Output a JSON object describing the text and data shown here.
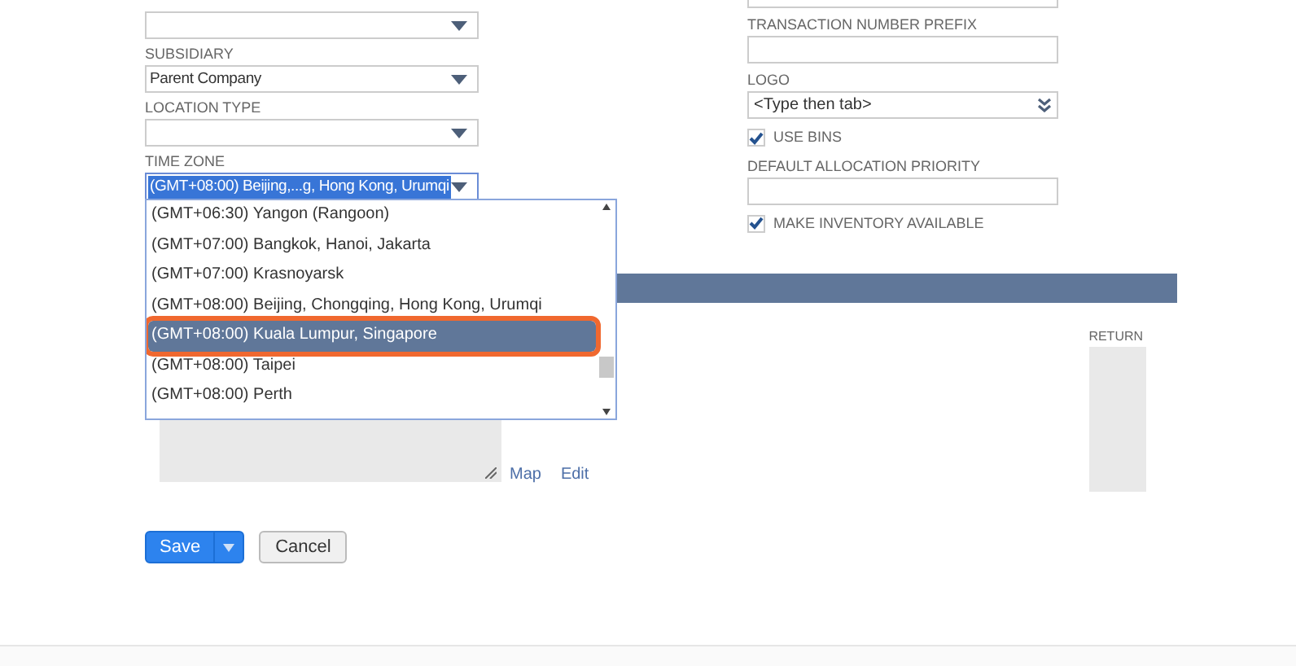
{
  "left_fields": [
    {
      "kind": "select"
    },
    {
      "label": "SUBSIDIARY",
      "kind": "select",
      "value": "Parent Company"
    },
    {
      "label": "LOCATION TYPE",
      "kind": "select"
    },
    {
      "label": "TIME ZONE",
      "kind": "select-focused",
      "value": "(GMT+08:00) Beijing,...g, Hong Kong, Urumqi"
    }
  ],
  "right_fields": [
    {
      "label": "TRANSACTION NUMBER PREFIX",
      "kind": "text"
    },
    {
      "label": "LOGO",
      "kind": "autocomplete",
      "value": "<Type then tab>"
    },
    {
      "label": "USE BINS",
      "kind": "checkbox",
      "checked": true
    },
    {
      "label": "DEFAULT ALLOCATION PRIORITY",
      "kind": "text"
    },
    {
      "label": "MAKE INVENTORY AVAILABLE",
      "kind": "checkbox",
      "checked": true
    }
  ],
  "timezone_options": [
    {
      "label": "(GMT+06:30) Yangon (Rangoon)",
      "selected": false
    },
    {
      "label": "(GMT+07:00) Bangkok, Hanoi, Jakarta",
      "selected": false
    },
    {
      "label": "(GMT+07:00) Krasnoyarsk",
      "selected": false
    },
    {
      "label": "(GMT+08:00) Beijing, Chongqing, Hong Kong, Urumqi",
      "selected": false
    },
    {
      "label": "(GMT+08:00) Kuala Lumpur, Singapore",
      "selected": true
    },
    {
      "label": "(GMT+08:00) Taipei",
      "selected": false
    },
    {
      "label": "(GMT+08:00) Perth",
      "selected": false
    }
  ],
  "address_links": [
    "Map",
    "Edit"
  ],
  "return_label": "RETURN",
  "buttons": {
    "save": "Save",
    "cancel": "Cancel"
  }
}
